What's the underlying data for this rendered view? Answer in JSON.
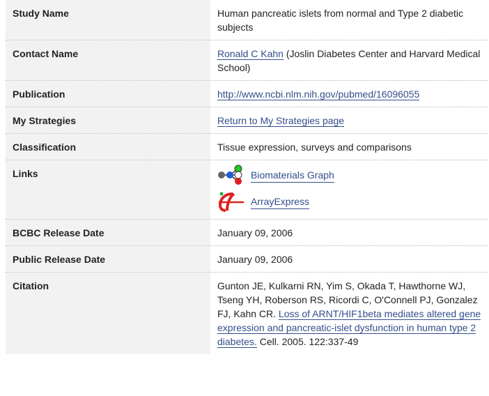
{
  "rows": {
    "study_name": {
      "label": "Study Name",
      "value": "Human pancreatic islets from normal and Type 2 diabetic subjects"
    },
    "contact_name": {
      "label": "Contact Name",
      "link": "Ronald C Kahn",
      "suffix": " (Joslin Diabetes Center and Harvard Medical School)"
    },
    "publication": {
      "label": "Publication",
      "link": "http://www.ncbi.nlm.nih.gov/pubmed/16096055"
    },
    "my_strategies": {
      "label": "My Strategies",
      "link": "Return to My Strategies page"
    },
    "classification": {
      "label": "Classification",
      "value": "Tissue expression, surveys and comparisons"
    },
    "links": {
      "label": "Links",
      "items": [
        {
          "icon": "biomaterials-graph-icon",
          "text": "Biomaterials Graph"
        },
        {
          "icon": "arrayexpress-icon",
          "text": "ArrayExpress"
        }
      ]
    },
    "bcbc_release_date": {
      "label": "BCBC Release Date",
      "value": "January 09, 2006"
    },
    "public_release_date": {
      "label": "Public Release Date",
      "value": "January 09, 2006"
    },
    "citation": {
      "label": "Citation",
      "prefix": "Gunton JE, Kulkarni RN, Yim S, Okada T, Hawthorne WJ, Tseng YH, Roberson RS, Ricordi C, O'Connell PJ, Gonzalez FJ, Kahn CR. ",
      "link": "Loss of ARNT/HIF1beta mediates altered gene expression and pancreatic-islet dysfunction in human type 2 diabetes.",
      "suffix": " Cell. 2005. 122:337-49"
    }
  },
  "colors": {
    "link": "#334e8c",
    "label_bg": "#f2f2f2",
    "divider": "#b8b8b8"
  }
}
